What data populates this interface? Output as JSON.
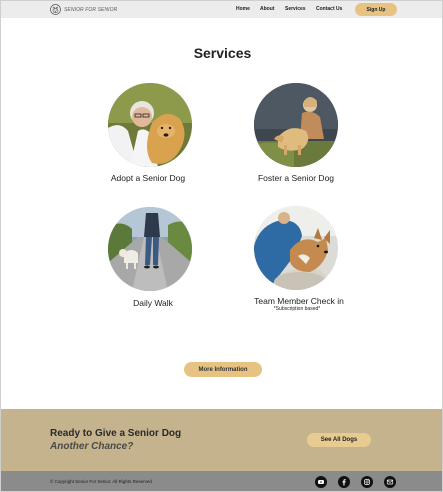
{
  "header": {
    "brand": "SENIOR FOR SENIOR",
    "nav": [
      "Home",
      "About",
      "Services",
      "Contact Us"
    ],
    "signup_label": "Sign Up"
  },
  "services": {
    "title": "Services",
    "items": [
      {
        "label": "Adopt a Senior Dog",
        "subtitle": ""
      },
      {
        "label": "Foster a Senior Dog",
        "subtitle": ""
      },
      {
        "label": "Daily Walk",
        "subtitle": ""
      },
      {
        "label": "Team Member Check in",
        "subtitle": "*Subscription based*"
      }
    ],
    "more_label": "More Information"
  },
  "cta": {
    "title": "Ready to Give a Senior Dog",
    "subtitle": "Another Chance?",
    "button_label": "See All Dogs"
  },
  "footer": {
    "copyright": "© Copyright Senior For Senior. All Rights Reserved",
    "social": [
      "youtube-icon",
      "facebook-icon",
      "instagram-icon",
      "email-icon"
    ]
  },
  "colors": {
    "accent": "#e6c383",
    "cta_band": "#c5b38d",
    "footer": "#8b8b8b"
  }
}
